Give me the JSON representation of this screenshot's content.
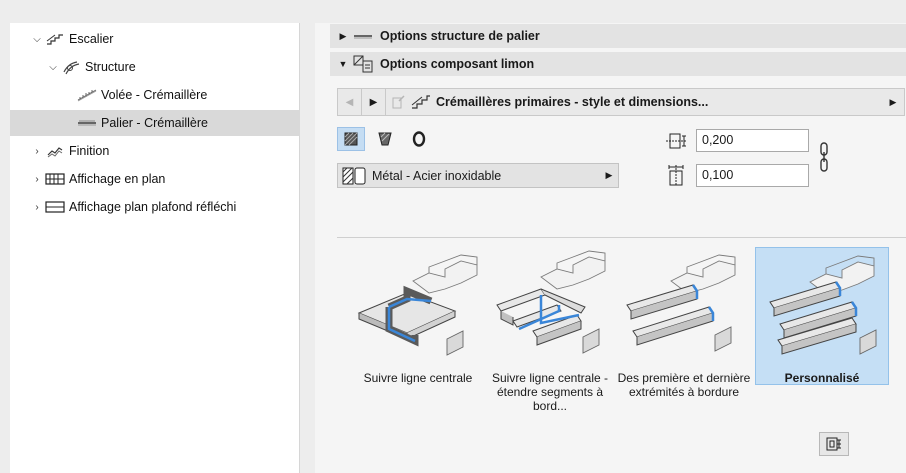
{
  "tree": {
    "items": [
      {
        "label": "Escalier",
        "expanded": true,
        "icon": "stair-icon"
      },
      {
        "label": "Structure",
        "expanded": true,
        "icon": "structure-icon"
      },
      {
        "label": "Volée - Crémaillère",
        "icon": "flight-icon"
      },
      {
        "label": "Palier - Crémaillère",
        "icon": "landing-icon",
        "selected": true
      },
      {
        "label": "Finition",
        "expanded": false,
        "icon": "finish-icon"
      },
      {
        "label": "Affichage en plan",
        "expanded": false,
        "icon": "plan-display-icon"
      },
      {
        "label": "Affichage plan plafond réfléchi",
        "expanded": false,
        "icon": "ceiling-plan-icon"
      }
    ]
  },
  "panel": {
    "section1": {
      "title": "Options structure de palier",
      "expanded": false
    },
    "section2": {
      "title": "Options composant limon",
      "expanded": true
    },
    "nav": {
      "label": "Crémaillères primaires - style et dimensions..."
    },
    "material": {
      "label": "Métal - Acier inoxidable"
    },
    "width_value": "0,200",
    "height_value": "0,100",
    "options": [
      {
        "label": "Suivre ligne centrale",
        "selected": false
      },
      {
        "label": "Suivre ligne centrale - étendre segments à bord...",
        "selected": false
      },
      {
        "label": "Des première et dernière extrémités à bordure",
        "selected": false
      },
      {
        "label": "Personnalisé",
        "selected": true
      }
    ]
  },
  "colors": {
    "selection": "#c5dff5",
    "accent_blue": "#3a86d8"
  }
}
